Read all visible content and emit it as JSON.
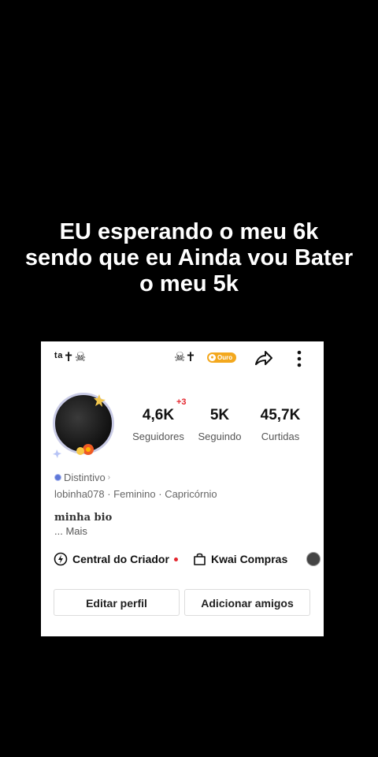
{
  "caption": {
    "line1": "EU esperando o meu 6k",
    "line2": "sendo que eu Ainda vou Bater",
    "line3": "o meu 5k"
  },
  "profile": {
    "nickname_left": "ᵗᵃ✝☠",
    "nickname_right": "☠✝",
    "gold_badge": "Ouro",
    "stats": [
      {
        "value": "4,6K",
        "label": "Seguidores",
        "delta": "+3"
      },
      {
        "value": "5K",
        "label": "Seguindo"
      },
      {
        "value": "45,7K",
        "label": "Curtidas"
      }
    ],
    "distintivo": "Distintivo",
    "tags": "lobinha078 · Feminino · Capricórnio",
    "bio": "minha bio",
    "more": "...  Mais",
    "creator_center": "Central do Criador",
    "shop": "Kwai Compras",
    "buttons": {
      "edit": "Editar perfil",
      "add_friends": "Adicionar amigos"
    }
  },
  "icons": {
    "share": "share-arrow-icon",
    "more": "more-vertical-icon",
    "creator": "lightning-circle-icon",
    "shop": "shopping-bag-icon"
  }
}
